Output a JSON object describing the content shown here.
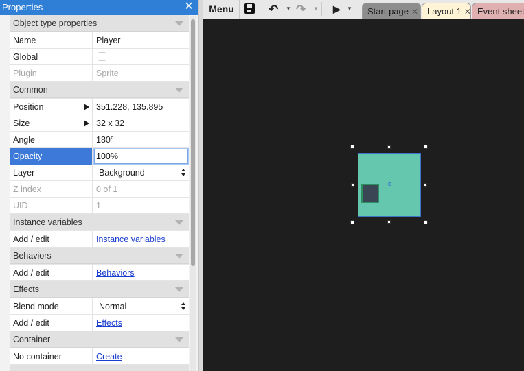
{
  "panel": {
    "title": "Properties",
    "close_glyph": "✕"
  },
  "sections": {
    "object_type": "Object type properties",
    "common": "Common",
    "instance_variables": "Instance variables",
    "behaviors": "Behaviors",
    "effects": "Effects",
    "container": "Container"
  },
  "props": {
    "name": {
      "label": "Name",
      "value": "Player"
    },
    "global": {
      "label": "Global",
      "checked": false
    },
    "plugin": {
      "label": "Plugin",
      "value": "Sprite"
    },
    "position": {
      "label": "Position",
      "value": "351.228, 135.895"
    },
    "size": {
      "label": "Size",
      "value": "32 x 32"
    },
    "angle": {
      "label": "Angle",
      "value": "180°"
    },
    "opacity": {
      "label": "Opacity",
      "value": "100%"
    },
    "layer": {
      "label": "Layer",
      "value": "Background"
    },
    "z_index": {
      "label": "Z index",
      "value": "0 of 1"
    },
    "uid": {
      "label": "UID",
      "value": "1"
    },
    "instance_vars_edit": {
      "label": "Add / edit",
      "link": "Instance variables"
    },
    "behaviors_edit": {
      "label": "Add / edit",
      "link": "Behaviors"
    },
    "blend_mode": {
      "label": "Blend mode",
      "value": "Normal"
    },
    "effects_edit": {
      "label": "Add / edit",
      "link": "Effects"
    },
    "container": {
      "label": "No container",
      "link": "Create"
    }
  },
  "toolbar": {
    "menu_label": "Menu",
    "save_icon": "floppy-disk-icon",
    "undo_glyph": "↶",
    "redo_glyph": "↷",
    "run_glyph": "▶",
    "caret_glyph": "▼"
  },
  "tabs": [
    {
      "label": "Start page",
      "close": "✕"
    },
    {
      "label": "Layout 1",
      "close": "✕"
    },
    {
      "label": "Event sheet"
    }
  ],
  "colors": {
    "panel_header": "#2f7fd6",
    "selection": "#3d79d8",
    "sprite_fill": "#65c7ae",
    "canvas_bg": "#1e1e1e"
  }
}
